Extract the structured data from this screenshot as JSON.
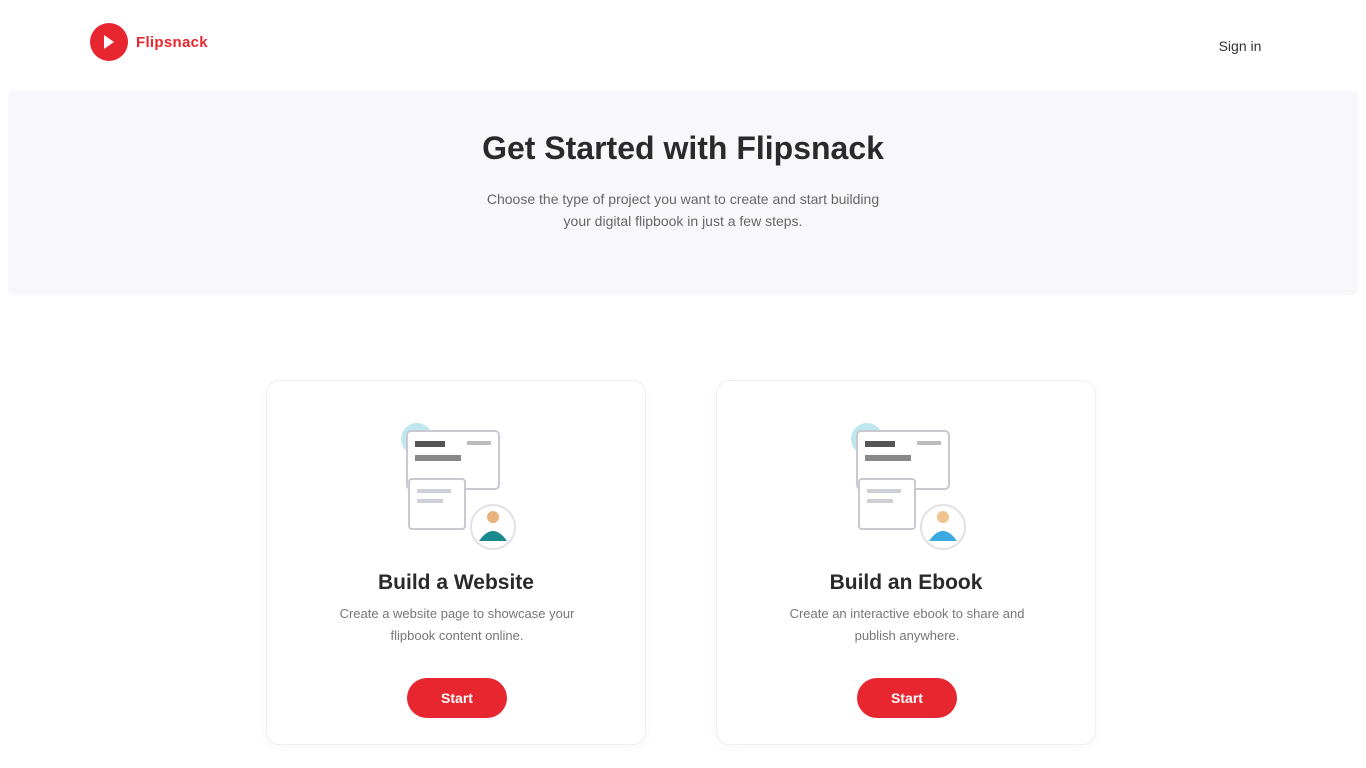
{
  "header": {
    "logo_text": "Flipsnack",
    "signin_label": "Sign in"
  },
  "hero": {
    "title": "Get Started with Flipsnack",
    "subtitle": "Choose the type of project you want to create and start building your digital flipbook in just a few steps."
  },
  "cards": [
    {
      "title": "Build a Website",
      "description": "Create a website page to showcase your flipbook content online.",
      "button_label": "Start"
    },
    {
      "title": "Build an Ebook",
      "description": "Create an interactive ebook to share and publish anywhere.",
      "button_label": "Start"
    }
  ],
  "colors": {
    "brand": "#e8262f",
    "hero_bg": "#f8f8fc",
    "accent_teal": "#1a8a8f",
    "accent_blue": "#3aa9e0"
  },
  "icons": {
    "logo": "logo-icon",
    "website_illustration": "website-illustration",
    "ebook_illustration": "ebook-illustration"
  }
}
